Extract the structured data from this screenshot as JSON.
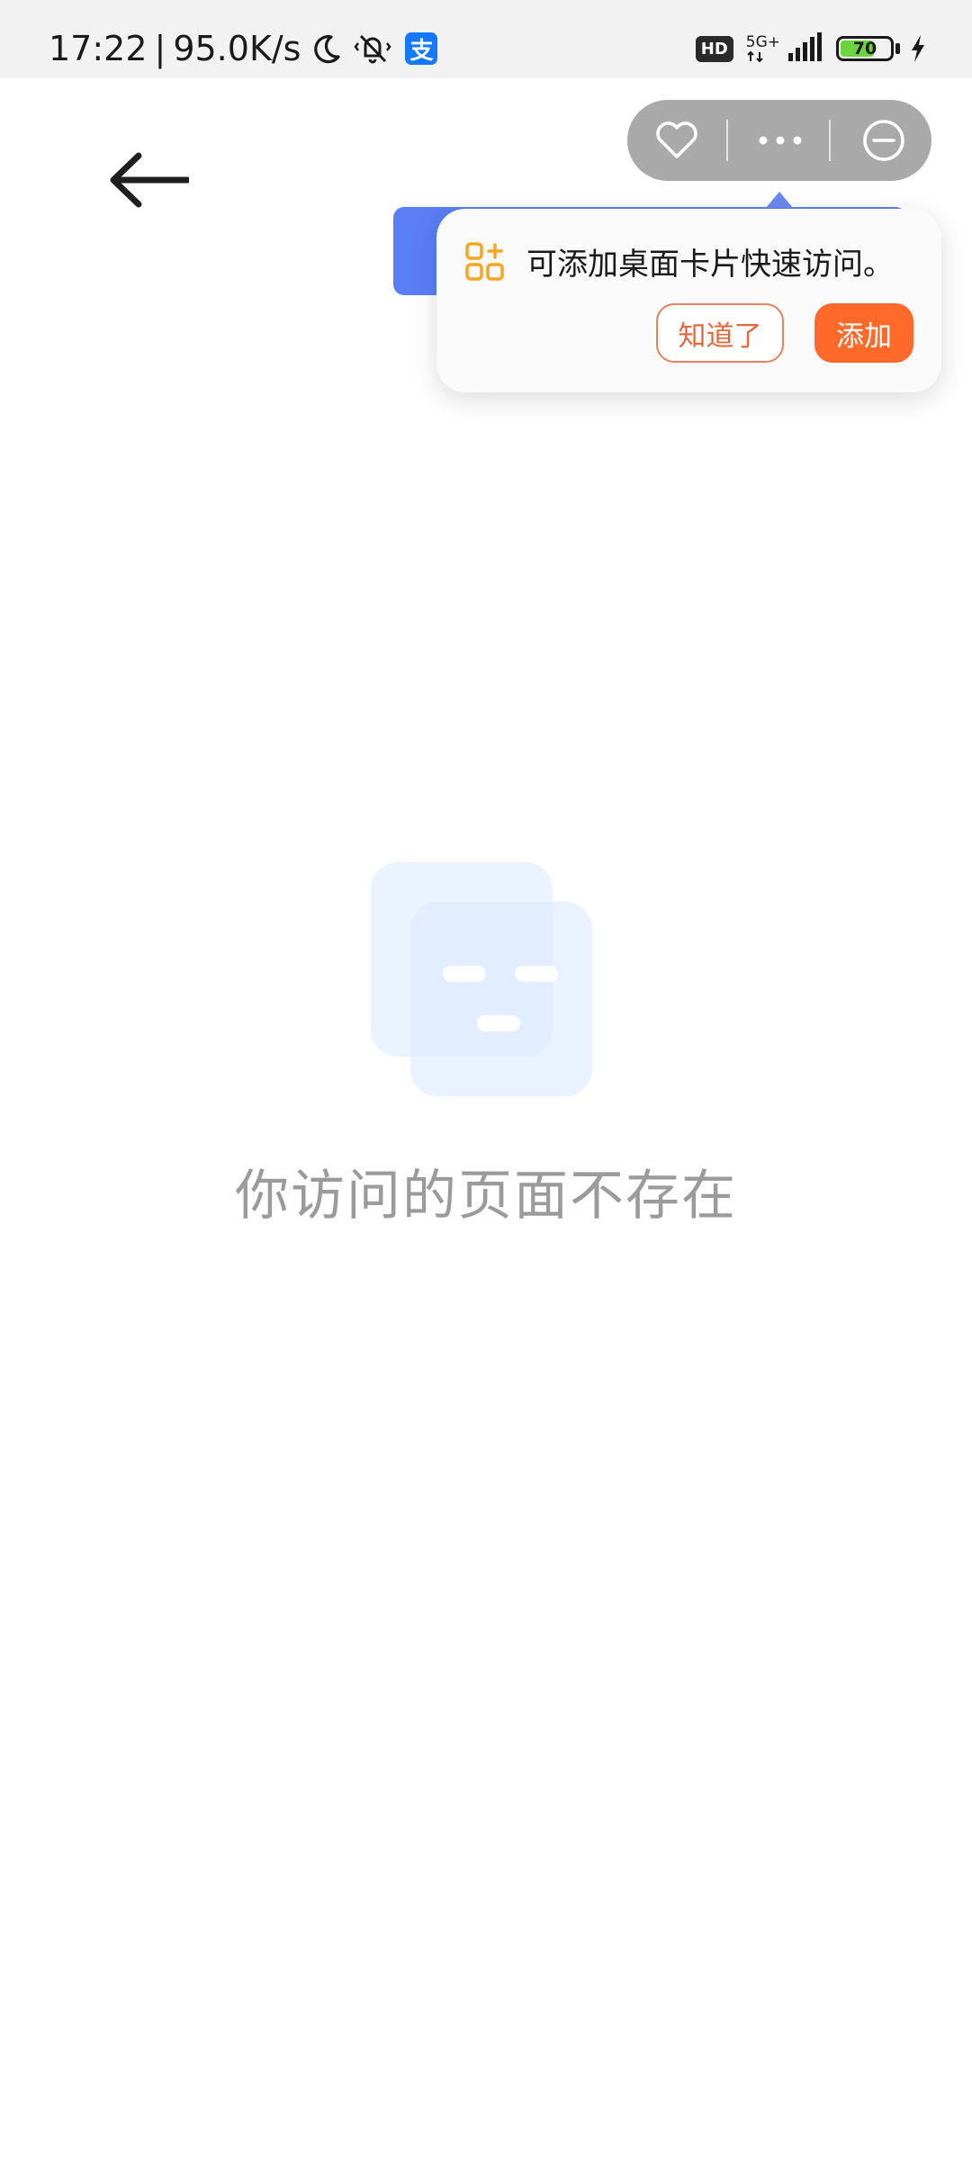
{
  "status_bar": {
    "time": "17:22",
    "separator": "|",
    "net_speed": "95.0K/s",
    "alipay_badge": "支",
    "hd_label": "HD",
    "network_label": "5G+",
    "battery_level": "70",
    "icons": [
      "moon-icon",
      "mute-bell-icon",
      "alipay-icon",
      "signal-icon",
      "battery-icon",
      "charging-icon"
    ]
  },
  "capsule": {
    "icons": [
      "heart-icon",
      "more-icon",
      "minimize-icon"
    ]
  },
  "tooltip": {
    "message": "可添加桌面卡片快速访问。",
    "dismiss_label": "知道了",
    "add_label": "添加"
  },
  "empty_state": {
    "message": "你访问的页面不存在"
  },
  "colors": {
    "accent_orange": "#ff6a2a",
    "blue": "#5a7ff5",
    "battery_green": "#6ad43c",
    "capsule_gray": "#a9a9a9"
  }
}
